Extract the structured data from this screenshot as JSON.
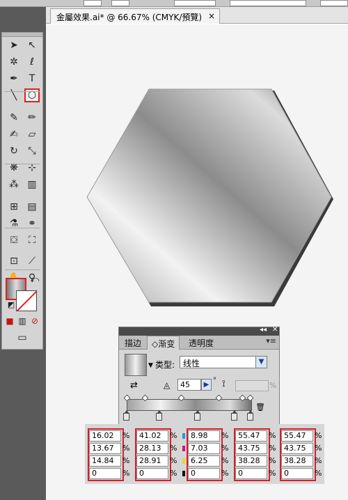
{
  "document_tab": {
    "title": "金屬效果.ai* @ 66.67% (CMYK/預覽)",
    "close": "×"
  },
  "toolbox": {
    "tools": [
      {
        "name": "selection-tool",
        "glyph": "➤"
      },
      {
        "name": "direct-selection-tool",
        "glyph": "↖"
      },
      {
        "name": "magic-wand-tool",
        "glyph": "✲"
      },
      {
        "name": "lasso-tool",
        "glyph": "ℓ"
      },
      {
        "name": "pen-tool",
        "glyph": "✒"
      },
      {
        "name": "type-tool",
        "glyph": "T"
      },
      {
        "name": "line-tool",
        "glyph": "╲"
      },
      {
        "name": "polygon-tool",
        "glyph": "⬡"
      },
      {
        "name": "paintbrush-tool",
        "glyph": "✎"
      },
      {
        "name": "pencil-tool",
        "glyph": "✏"
      },
      {
        "name": "blob-brush-tool",
        "glyph": "✍"
      },
      {
        "name": "eraser-tool",
        "glyph": "▱"
      },
      {
        "name": "rotate-tool",
        "glyph": "↻"
      },
      {
        "name": "scale-tool",
        "glyph": "⤡"
      },
      {
        "name": "warp-tool",
        "glyph": "❋"
      },
      {
        "name": "free-transform-tool",
        "glyph": "⊹"
      },
      {
        "name": "symbol-sprayer-tool",
        "glyph": "⁂"
      },
      {
        "name": "column-graph-tool",
        "glyph": "▥"
      },
      {
        "name": "mesh-tool",
        "glyph": "⊞"
      },
      {
        "name": "gradient-tool",
        "glyph": "▤"
      },
      {
        "name": "eyedropper-tool",
        "glyph": "⚗"
      },
      {
        "name": "blend-tool",
        "glyph": "⚭"
      },
      {
        "name": "live-paint-bucket-tool",
        "glyph": "⛋"
      },
      {
        "name": "live-paint-selection-tool",
        "glyph": "⛶"
      },
      {
        "name": "artboard-tool",
        "glyph": "⊡"
      },
      {
        "name": "slice-tool",
        "glyph": "⟋"
      },
      {
        "name": "hand-tool",
        "glyph": "✋"
      },
      {
        "name": "zoom-tool",
        "glyph": "⚲"
      }
    ],
    "swap_glyph": "⤺",
    "default_glyph": "◩",
    "mode_glyphs": [
      "■",
      "▥",
      "⊘"
    ],
    "screen_mode_glyph": "▭"
  },
  "gradient_panel": {
    "collapse": "◂◂",
    "close": "✕",
    "tabs": [
      "描边",
      "◇渐变",
      "透明度"
    ],
    "menu": "▾≡",
    "type_label": "类型:",
    "type_value": "线性",
    "dropdown_arrow": "▼",
    "angle_icon": "◬",
    "angle_value": "45",
    "angle_step": "▶",
    "degree_sign": "°",
    "location_icon": "⟟",
    "location_pct": "%",
    "trash_icon": "🗑",
    "reverse_icon": "⇄",
    "gradient_colors": [
      "#a0a0a0",
      "#f2f2f2",
      "#8c8c8c",
      "#dcdcdc",
      "#6e6e6e"
    ]
  },
  "cmyk_stops": [
    {
      "c": "16.02",
      "m": "13.67",
      "y": "14.84",
      "k": "0"
    },
    {
      "c": "41.02",
      "m": "28.13",
      "y": "28.91",
      "k": "0"
    },
    {
      "c": "8.98",
      "m": "7.03",
      "y": "6.25",
      "k": "0"
    },
    {
      "c": "55.47",
      "m": "43.75",
      "y": "38.28",
      "k": "0"
    },
    {
      "c": "55.47",
      "m": "43.75",
      "y": "38.28",
      "k": "0"
    }
  ],
  "percent_sign": "%",
  "colors": {
    "highlight_red": "#d81e2a",
    "channel_cyan": "#1aa0d8",
    "channel_magenta": "#d0187a",
    "channel_yellow": "#e8d820",
    "channel_black": "#111111"
  }
}
